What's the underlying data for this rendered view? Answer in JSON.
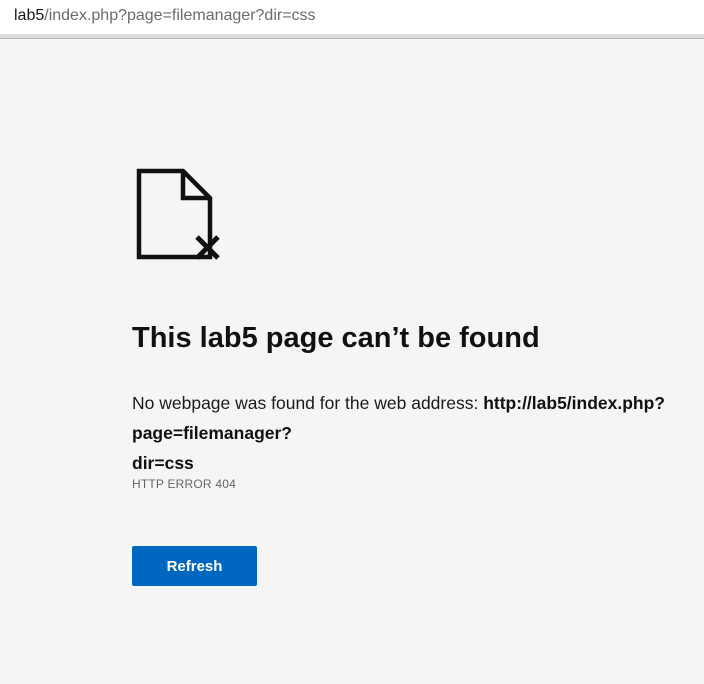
{
  "address_bar": {
    "host": "lab5",
    "path": "/index.php?page=filemanager?dir=css"
  },
  "error": {
    "icon": "page-not-found-icon",
    "title": "This lab5 page can’t be found",
    "description_prefix": "No webpage was found for the web address: ",
    "url_line1": "http://lab5/index.php?page=filemanager?",
    "url_line2": "dir=css",
    "code": "HTTP ERROR 404",
    "refresh_label": "Refresh"
  },
  "colors": {
    "background": "#f5f5f5",
    "accent": "#0067c0",
    "text": "#111111",
    "muted": "#666666"
  }
}
